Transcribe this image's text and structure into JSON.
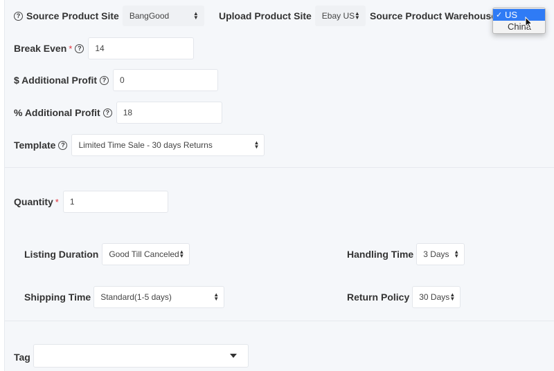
{
  "header": {
    "source_site": {
      "label": "Source Product Site",
      "value": "BangGood"
    },
    "upload_site": {
      "label": "Upload Product Site",
      "value": "Ebay US"
    },
    "source_warehouse": {
      "label": "Source Product Warehouse",
      "options": [
        "US",
        "China"
      ],
      "selected": "US"
    }
  },
  "form": {
    "break_even": {
      "label": "Break Even",
      "required_mark": "*",
      "value": "14"
    },
    "additional_profit_dollar": {
      "label": "$ Additional Profit",
      "value": "0"
    },
    "additional_profit_percent": {
      "label": "% Additional Profit",
      "value": "18"
    },
    "template": {
      "label": "Template",
      "value": "Limited Time Sale - 30 days Returns"
    },
    "quantity": {
      "label": "Quantity",
      "required_mark": "*",
      "value": "1"
    },
    "listing_duration": {
      "label": "Listing Duration",
      "value": "Good Till Canceled"
    },
    "handling_time": {
      "label": "Handling Time",
      "value": "3 Days"
    },
    "shipping_time": {
      "label": "Shipping Time",
      "value": "Standard(1-5 days)"
    },
    "return_policy": {
      "label": "Return Policy",
      "value": "30 Days"
    },
    "tag": {
      "label": "Tag",
      "value": ""
    }
  },
  "glyphs": {
    "help": "?",
    "check": "✓",
    "up": "▲",
    "down": "▼"
  },
  "colors": {
    "background": "#f5f7fa",
    "required": "#e0303a",
    "selected_option": "#2f7bf5"
  }
}
